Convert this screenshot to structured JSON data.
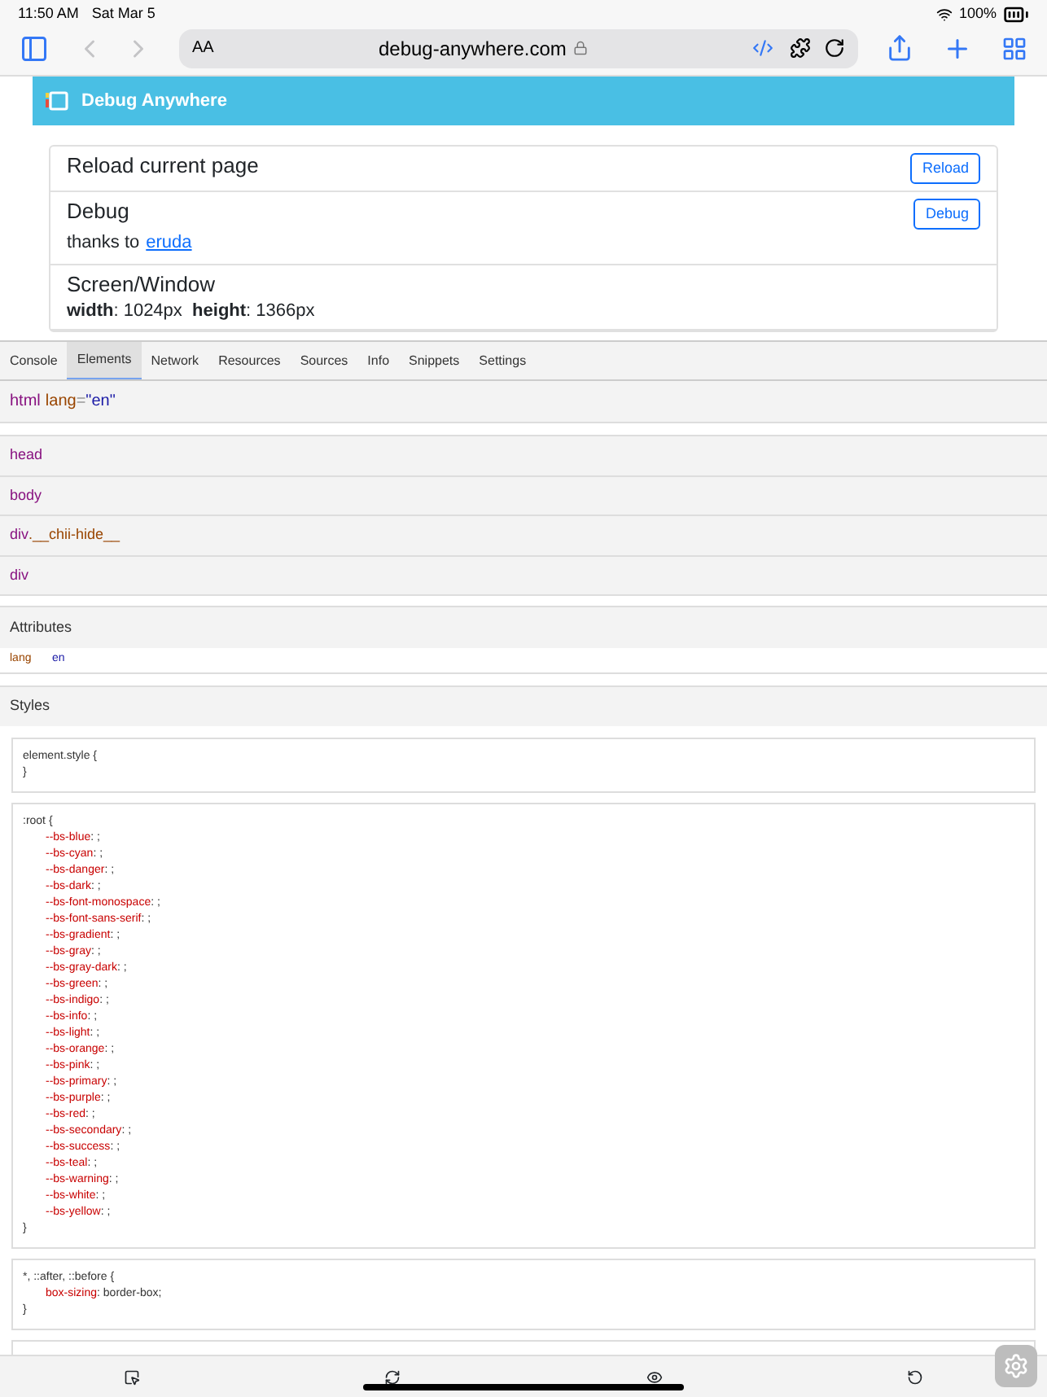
{
  "status_bar": {
    "time": "11:50 AM",
    "date": "Sat Mar 5",
    "battery": "100%"
  },
  "browser": {
    "text_size": "AA",
    "url": "debug-anywhere.com"
  },
  "page": {
    "header_title": "Debug Anywhere",
    "cards": [
      {
        "kind": "action",
        "title": "Reload current page",
        "button": "Reload"
      },
      {
        "kind": "action",
        "title": "Debug",
        "button": "Debug",
        "note": "thanks to",
        "link": "eruda"
      },
      {
        "kind": "info",
        "title": "Screen/Window",
        "lines": [
          "**width**: 1024px  **height**: 1366px"
        ]
      }
    ]
  },
  "devtools": {
    "tabs": [
      {
        "label": "Console",
        "selected": false
      },
      {
        "label": "Elements",
        "selected": true
      },
      {
        "label": "Network",
        "selected": false
      },
      {
        "label": "Resources",
        "selected": false
      },
      {
        "label": "Sources",
        "selected": false
      },
      {
        "label": "Info",
        "selected": false
      },
      {
        "label": "Snippets",
        "selected": false
      },
      {
        "label": "Settings",
        "selected": false
      }
    ],
    "element_path": {
      "tag": "html",
      "attr": "lang",
      "eq": "=",
      "value": "\"en\""
    },
    "tree": [
      {
        "tag": "head"
      },
      {
        "tag": "body"
      },
      {
        "tag": "div",
        "class_name": ".__chii-hide__"
      },
      {
        "tag": "div"
      }
    ],
    "attributes": {
      "title": "Attributes",
      "items": [
        {
          "name": "lang",
          "value": "en"
        }
      ]
    },
    "styles": {
      "title": "Styles",
      "rules": [
        {
          "selector": "element.style {",
          "close": "}"
        },
        {
          "selector": ":root {",
          "declarations": [
            {
              "property": "--bs-blue",
              "rest": ": ;"
            },
            {
              "property": "--bs-cyan",
              "rest": ": ;"
            },
            {
              "property": "--bs-danger",
              "rest": ": ;"
            },
            {
              "property": "--bs-dark",
              "rest": ": ;"
            },
            {
              "property": "--bs-font-monospace",
              "rest": ": ;"
            },
            {
              "property": "--bs-font-sans-serif",
              "rest": ": ;"
            },
            {
              "property": "--bs-gradient",
              "rest": ": ;"
            },
            {
              "property": "--bs-gray",
              "rest": ": ;"
            },
            {
              "property": "--bs-gray-dark",
              "rest": ": ;"
            },
            {
              "property": "--bs-green",
              "rest": ": ;"
            },
            {
              "property": "--bs-indigo",
              "rest": ": ;"
            },
            {
              "property": "--bs-info",
              "rest": ": ;"
            },
            {
              "property": "--bs-light",
              "rest": ": ;"
            },
            {
              "property": "--bs-orange",
              "rest": ": ;"
            },
            {
              "property": "--bs-pink",
              "rest": ": ;"
            },
            {
              "property": "--bs-primary",
              "rest": ": ;"
            },
            {
              "property": "--bs-purple",
              "rest": ": ;"
            },
            {
              "property": "--bs-red",
              "rest": ": ;"
            },
            {
              "property": "--bs-secondary",
              "rest": ": ;"
            },
            {
              "property": "--bs-success",
              "rest": ": ;"
            },
            {
              "property": "--bs-teal",
              "rest": ": ;"
            },
            {
              "property": "--bs-warning",
              "rest": ": ;"
            },
            {
              "property": "--bs-white",
              "rest": ": ;"
            },
            {
              "property": "--bs-yellow",
              "rest": ": ;"
            }
          ],
          "close": "}"
        },
        {
          "selector": "*, ::after, ::before {",
          "declarations": [
            {
              "property": "box-sizing",
              "rest": ": border-box;"
            }
          ],
          "close": "}"
        }
      ]
    }
  }
}
